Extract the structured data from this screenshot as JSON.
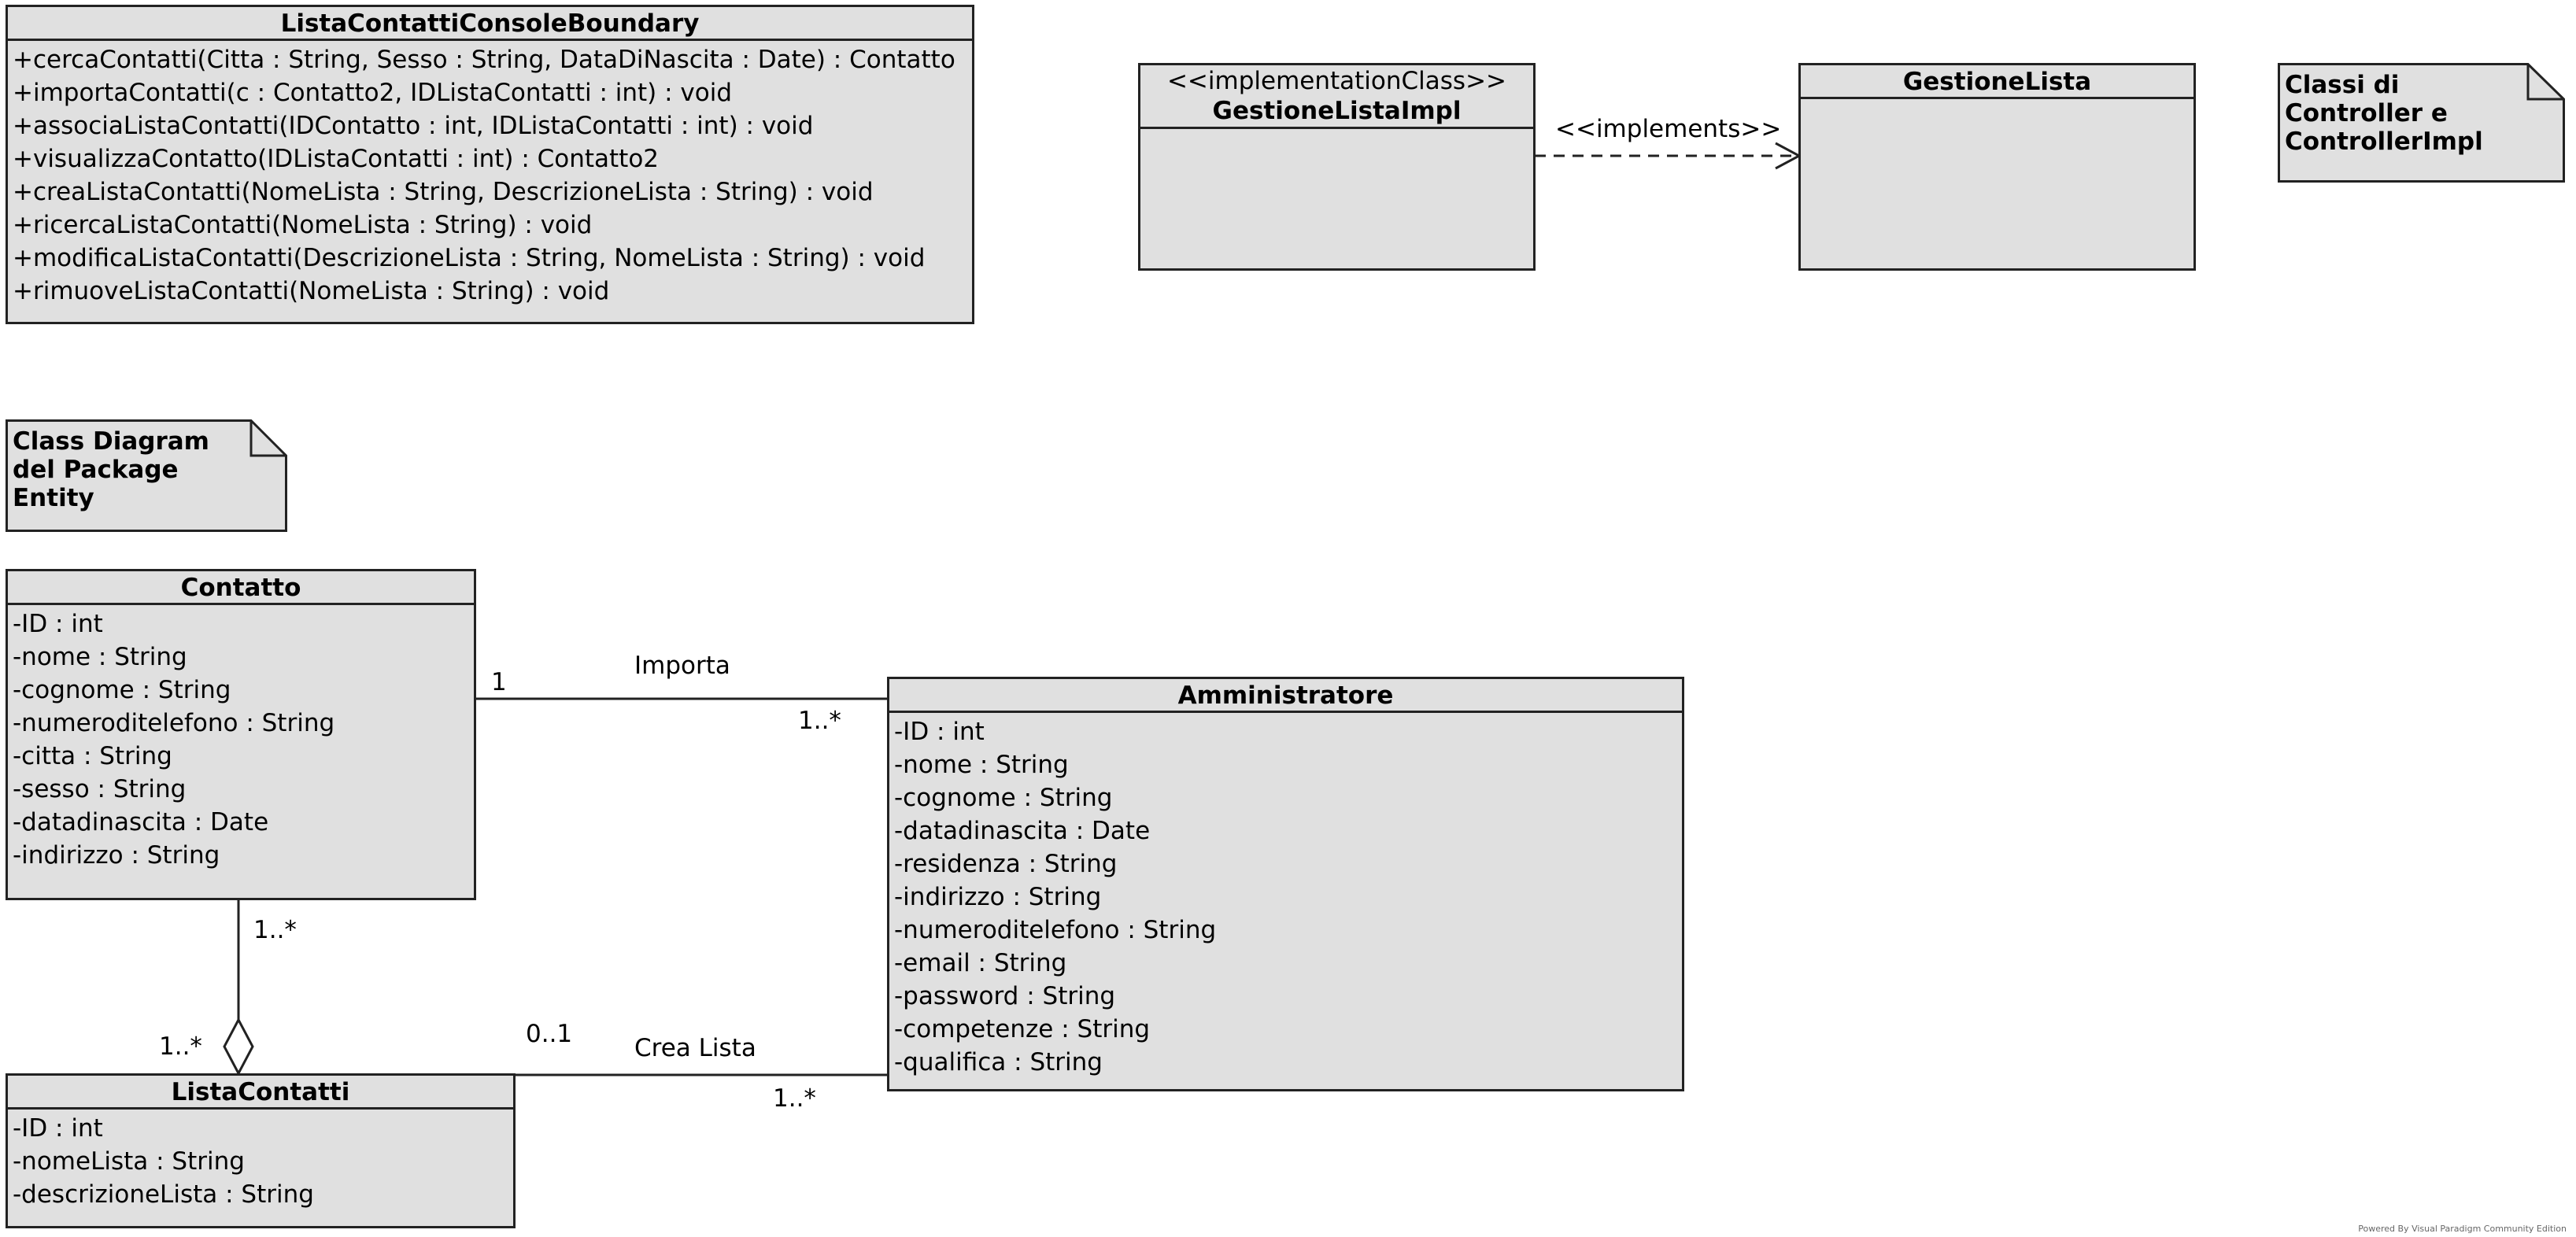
{
  "boundary": {
    "name": "ListaContattiConsoleBoundary",
    "methods": [
      "+cercaContatti(Citta : String, Sesso : String, DataDiNascita : Date) : Contatto",
      "+importaContatti(c : Contatto2, IDListaContatti : int) : void",
      "+associaListaContatti(IDContatto : int, IDListaContatti : int) : void",
      "+visualizzaContatto(IDListaContatti : int) : Contatto2",
      "+creaListaContatti(NomeLista : String, DescrizioneLista : String) : void",
      "+ricercaListaContatti(NomeLista : String) : void",
      "+modificaListaContatti(DescrizioneLista : String, NomeLista : String) : void",
      "+rimuoveListaContatti(NomeLista : String) : void"
    ]
  },
  "impl": {
    "stereotype": "<<implementationClass>>",
    "name": "GestioneListaImpl"
  },
  "gestione": {
    "name": "GestioneLista"
  },
  "implements_label": "<<implements>>",
  "note_controller": "Classi di\nController e\nControllerImpl",
  "note_entity": "Class Diagram\ndel Package\nEntity",
  "contatto": {
    "name": "Contatto",
    "attributes": [
      "-ID : int",
      "-nome : String",
      "-cognome : String",
      "-numeroditelefono : String",
      "-citta : String",
      "-sesso : String",
      "-datadinascita : Date",
      "-indirizzo : String"
    ]
  },
  "amministratore": {
    "name": "Amministratore",
    "attributes": [
      "-ID : int",
      "-nome : String",
      "-cognome : String",
      "-datadinascita : Date",
      "-residenza : String",
      "-indirizzo : String",
      "-numeroditelefono : String",
      "-email : String",
      "-password : String",
      "-competenze : String",
      "-qualifica : String"
    ]
  },
  "lista": {
    "name": "ListaContatti",
    "attributes": [
      "-ID : int",
      "-nomeLista : String",
      "-descrizioneLista : String"
    ]
  },
  "associations": {
    "importa": {
      "label": "Importa",
      "mult_contatto": "1",
      "mult_admin": "1..*"
    },
    "crea_lista": {
      "label": "Crea Lista",
      "mult_lista": "0..1",
      "mult_admin": "1..*"
    },
    "aggregation": {
      "mult_contatto": "1..*",
      "mult_lista": "1..*"
    }
  },
  "footer": "Powered By Visual Paradigm Community Edition"
}
